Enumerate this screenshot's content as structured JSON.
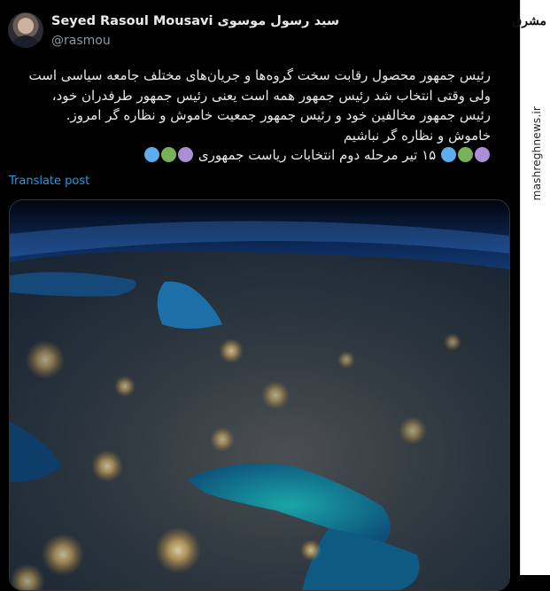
{
  "author": {
    "name": "Seyed Rasoul Mousavi سید رسول موسوی",
    "handle": "@rasmou"
  },
  "post": {
    "lines": [
      "رئیس جمهور محصول رقابت سخت گروه‌ها و جریان‌های مختلف جامعه سیاسی است",
      "ولی وقتی انتخاب شد رئیس جمهور همه است یعنی رئیس جمهور طرفدران خود،",
      "رئیس جمهور مخالفین خود و رئیس جمهور جمعیت خاموش و نظاره گر امروز.",
      "خاموش و نظاره گر نباشیم"
    ],
    "last_line": "۱۵ تیر مرحله دوم انتخابات ریاست جمهوری",
    "dot_colors": [
      "#5dadec",
      "#78b159",
      "#aa8ed6"
    ],
    "translate_label": "Translate post"
  },
  "watermark": {
    "logo": "مشرق",
    "url": "mashreghnews.ir"
  },
  "icons": {
    "circle_blue": "large-blue-circle",
    "circle_green": "large-green-circle",
    "circle_purple": "large-purple-circle"
  }
}
